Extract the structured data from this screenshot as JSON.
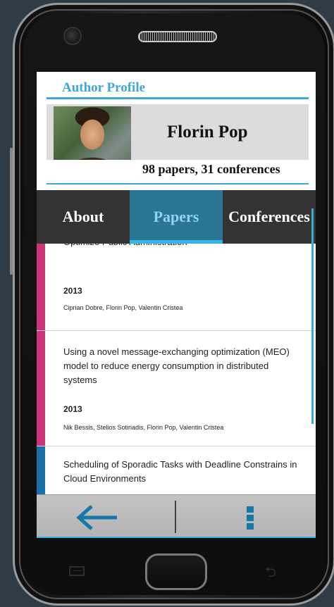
{
  "profile": {
    "section_title": "Author Profile",
    "name": "Florin Pop",
    "stats": "98 papers, 31 conferences",
    "avatar_icon": "author-photo"
  },
  "tabs": [
    {
      "label": "About",
      "active": false
    },
    {
      "label": "Papers",
      "active": true
    },
    {
      "label": "Conferences",
      "active": false
    }
  ],
  "papers": [
    {
      "title": "Optimize Public Administration",
      "year": "2013",
      "authors": "Ciprian Dobre, Florin Pop, Valentin Cristea",
      "stripe_color": "#c8357a"
    },
    {
      "title": "Using a novel message-exchanging optimization (MEO) model to reduce energy consumption in distributed systems",
      "year": "2013",
      "authors": "Nik Bessis, Stelios Sotiriadis, Florin Pop, Valentin Cristea",
      "stripe_color": "#c8357a"
    },
    {
      "title": "Scheduling of Sporadic Tasks with Deadline Constrains in Cloud Environments",
      "year": "",
      "authors": "",
      "stripe_color": "#1a6fa8"
    }
  ],
  "navigation": {
    "back_icon": "arrow-left-icon",
    "menu_icon": "overflow-menu-icon"
  },
  "colors": {
    "accent": "#33b5e5",
    "tab_bar": "#333333",
    "active_tab": "#2a7494",
    "title": "#3fa7d6"
  }
}
